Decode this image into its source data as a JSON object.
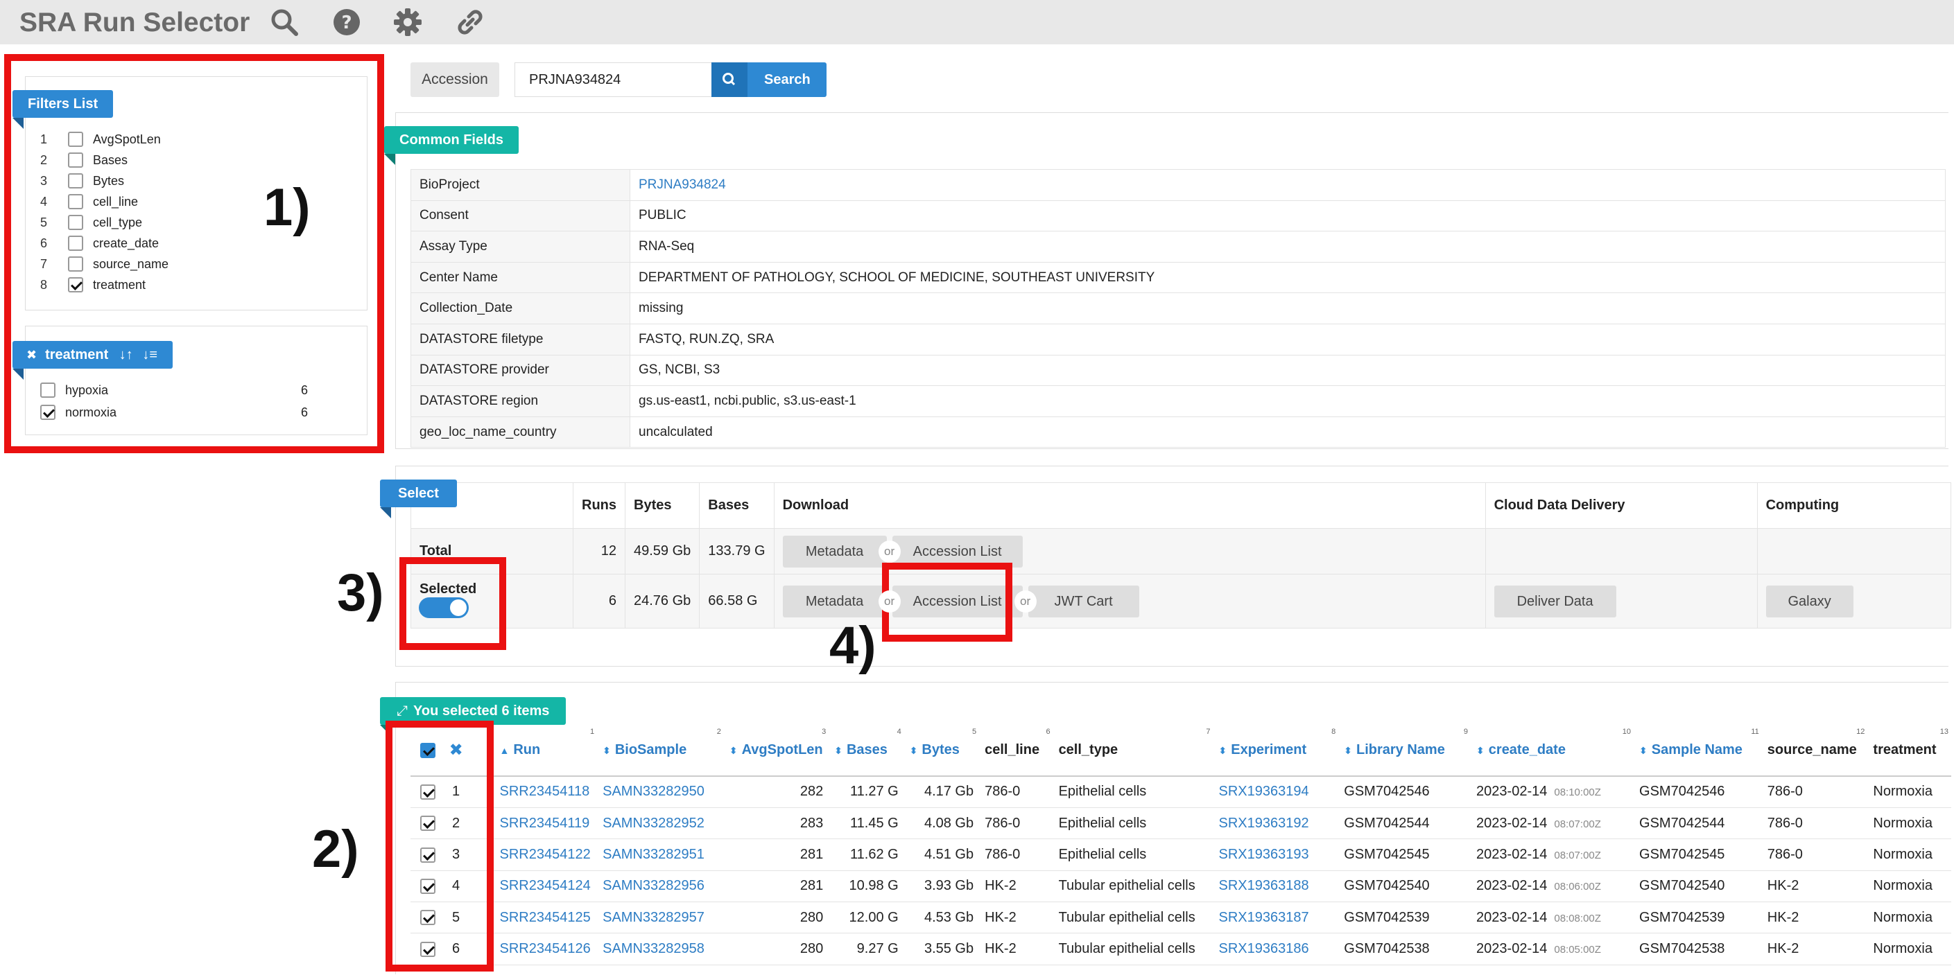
{
  "app": {
    "title": "SRA Run Selector",
    "icons": [
      "search-icon",
      "help-icon",
      "gear-icon",
      "link-icon"
    ]
  },
  "annotations": [
    "1)",
    "2)",
    "3)",
    "4)"
  ],
  "filters": {
    "title": "Filters List",
    "items": [
      {
        "index": "1",
        "label": "AvgSpotLen",
        "checked": false
      },
      {
        "index": "2",
        "label": "Bases",
        "checked": false
      },
      {
        "index": "3",
        "label": "Bytes",
        "checked": false
      },
      {
        "index": "4",
        "label": "cell_line",
        "checked": false
      },
      {
        "index": "5",
        "label": "cell_type",
        "checked": false
      },
      {
        "index": "6",
        "label": "create_date",
        "checked": false
      },
      {
        "index": "7",
        "label": "source_name",
        "checked": false
      },
      {
        "index": "8",
        "label": "treatment",
        "checked": true
      }
    ]
  },
  "treatment_filter": {
    "title": "treatment",
    "values": [
      {
        "label": "hypoxia",
        "count": "6",
        "checked": false
      },
      {
        "label": "normoxia",
        "count": "6",
        "checked": true
      }
    ]
  },
  "search": {
    "label": "Accession",
    "value": "PRJNA934824",
    "button": "Search"
  },
  "common_fields": {
    "title": "Common Fields",
    "rows": [
      {
        "key": "BioProject",
        "value": "PRJNA934824",
        "link": true
      },
      {
        "key": "Consent",
        "value": "PUBLIC"
      },
      {
        "key": "Assay Type",
        "value": "RNA-Seq"
      },
      {
        "key": "Center Name",
        "value": "DEPARTMENT OF PATHOLOGY, SCHOOL OF MEDICINE, SOUTHEAST UNIVERSITY"
      },
      {
        "key": "Collection_Date",
        "value": "missing"
      },
      {
        "key": "DATASTORE filetype",
        "value": "FASTQ, RUN.ZQ, SRA"
      },
      {
        "key": "DATASTORE provider",
        "value": "GS, NCBI, S3"
      },
      {
        "key": "DATASTORE region",
        "value": "gs.us-east1, ncbi.public, s3.us-east-1"
      },
      {
        "key": "geo_loc_name_country",
        "value": "uncalculated"
      }
    ]
  },
  "select": {
    "title": "Select",
    "headers": {
      "runs": "Runs",
      "bytes": "Bytes",
      "bases": "Bases",
      "download": "Download",
      "cloud": "Cloud Data Delivery",
      "computing": "Computing"
    },
    "total": {
      "label": "Total",
      "runs": "12",
      "bytes": "49.59 Gb",
      "bases": "133.79 G",
      "metadata": "Metadata",
      "or": "or",
      "accession_list": "Accession List"
    },
    "selected": {
      "label": "Selected",
      "runs": "6",
      "bytes": "24.76 Gb",
      "bases": "66.58 G",
      "metadata": "Metadata",
      "or": "or",
      "accession_list": "Accession List",
      "jwt_cart": "JWT Cart",
      "deliver": "Deliver Data",
      "galaxy": "Galaxy"
    }
  },
  "results": {
    "title": "You selected 6 items",
    "columns": [
      {
        "label": "Run",
        "num": "1"
      },
      {
        "label": "BioSample",
        "num": "2"
      },
      {
        "label": "AvgSpotLen",
        "num": "3"
      },
      {
        "label": "Bases",
        "num": "4"
      },
      {
        "label": "Bytes",
        "num": "5"
      },
      {
        "label": "cell_line",
        "num": "6"
      },
      {
        "label": "cell_type",
        "num": "7"
      },
      {
        "label": "Experiment",
        "num": "8"
      },
      {
        "label": "Library Name",
        "num": "9"
      },
      {
        "label": "create_date",
        "num": "10"
      },
      {
        "label": "Sample Name",
        "num": "11"
      },
      {
        "label": "source_name",
        "num": "12"
      },
      {
        "label": "treatment",
        "num": "13"
      }
    ],
    "rows": [
      {
        "n": "1",
        "run": "SRR23454118",
        "biosample": "SAMN33282950",
        "avgspotlen": "282",
        "bases": "11.27 G",
        "bytes": "4.17 Gb",
        "cell_line": "786-0",
        "cell_type": "Epithelial cells",
        "experiment": "SRX19363194",
        "library": "GSM7042546",
        "date": "2023-02-14",
        "time": "08:10:00Z",
        "sample": "GSM7042546",
        "source": "786-0",
        "treatment": "Normoxia"
      },
      {
        "n": "2",
        "run": "SRR23454119",
        "biosample": "SAMN33282952",
        "avgspotlen": "283",
        "bases": "11.45 G",
        "bytes": "4.08 Gb",
        "cell_line": "786-0",
        "cell_type": "Epithelial cells",
        "experiment": "SRX19363192",
        "library": "GSM7042544",
        "date": "2023-02-14",
        "time": "08:07:00Z",
        "sample": "GSM7042544",
        "source": "786-0",
        "treatment": "Normoxia"
      },
      {
        "n": "3",
        "run": "SRR23454122",
        "biosample": "SAMN33282951",
        "avgspotlen": "281",
        "bases": "11.62 G",
        "bytes": "4.51 Gb",
        "cell_line": "786-0",
        "cell_type": "Epithelial cells",
        "experiment": "SRX19363193",
        "library": "GSM7042545",
        "date": "2023-02-14",
        "time": "08:07:00Z",
        "sample": "GSM7042545",
        "source": "786-0",
        "treatment": "Normoxia"
      },
      {
        "n": "4",
        "run": "SRR23454124",
        "biosample": "SAMN33282956",
        "avgspotlen": "281",
        "bases": "10.98 G",
        "bytes": "3.93 Gb",
        "cell_line": "HK-2",
        "cell_type": "Tubular epithelial cells",
        "experiment": "SRX19363188",
        "library": "GSM7042540",
        "date": "2023-02-14",
        "time": "08:06:00Z",
        "sample": "GSM7042540",
        "source": "HK-2",
        "treatment": "Normoxia"
      },
      {
        "n": "5",
        "run": "SRR23454125",
        "biosample": "SAMN33282957",
        "avgspotlen": "280",
        "bases": "12.00 G",
        "bytes": "4.53 Gb",
        "cell_line": "HK-2",
        "cell_type": "Tubular epithelial cells",
        "experiment": "SRX19363187",
        "library": "GSM7042539",
        "date": "2023-02-14",
        "time": "08:08:00Z",
        "sample": "GSM7042539",
        "source": "HK-2",
        "treatment": "Normoxia"
      },
      {
        "n": "6",
        "run": "SRR23454126",
        "biosample": "SAMN33282958",
        "avgspotlen": "280",
        "bases": "9.27 G",
        "bytes": "3.55 Gb",
        "cell_line": "HK-2",
        "cell_type": "Tubular epithelial cells",
        "experiment": "SRX19363186",
        "library": "GSM7042538",
        "date": "2023-02-14",
        "time": "08:05:00Z",
        "sample": "GSM7042538",
        "source": "HK-2",
        "treatment": "Normoxia"
      }
    ]
  },
  "colors": {
    "primary": "#2e89d3",
    "teal": "#14b6a6",
    "annotation_red": "#ea1111",
    "link": "#2e7dc4"
  }
}
